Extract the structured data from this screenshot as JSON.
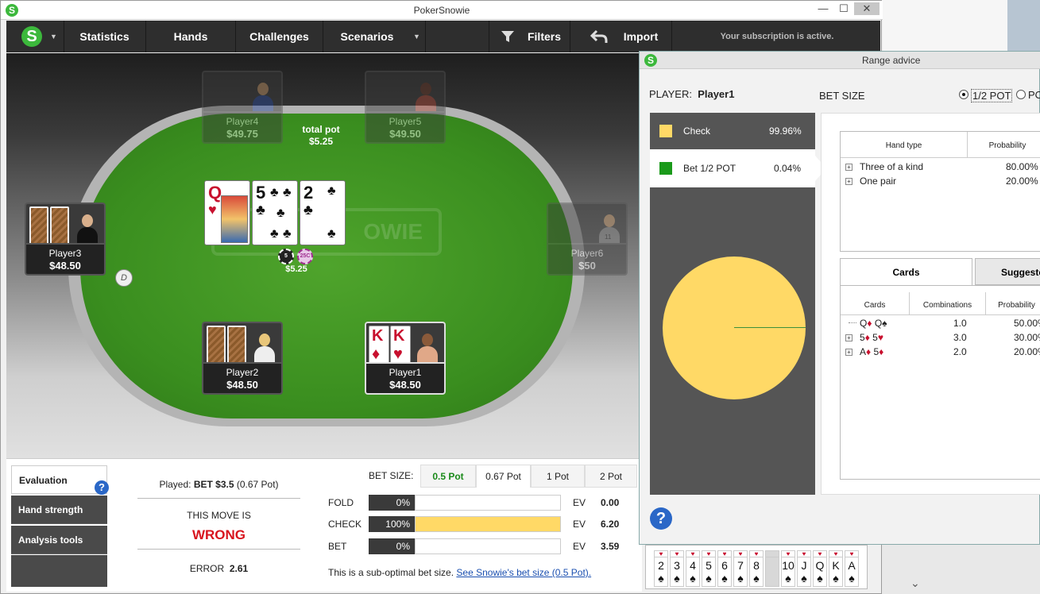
{
  "app": {
    "title": "PokerSnowie",
    "logo_letter": "S"
  },
  "window_buttons": {
    "minimize": "—",
    "maximize": "☐",
    "close": "✕"
  },
  "menu": {
    "items": [
      "Statistics",
      "Hands",
      "Challenges",
      "Scenarios"
    ],
    "filters": "Filters",
    "import": "Import",
    "subscription": "Your subscription is active."
  },
  "table": {
    "felt_logo": "OWIE",
    "total_pot_label": "total pot",
    "total_pot": "$5.25",
    "pot_chips": "$5.25",
    "chip1": "5",
    "chip2": "25C",
    "dealer": "D",
    "board": [
      {
        "rank": "Q",
        "suit": "♥",
        "color": "#c8102e"
      },
      {
        "rank": "5",
        "suit": "♣",
        "color": "#111111"
      },
      {
        "rank": "2",
        "suit": "♣",
        "color": "#111111"
      }
    ],
    "seats": [
      {
        "name": "Player4",
        "stack": "$49.75"
      },
      {
        "name": "Player5",
        "stack": "$49.50"
      },
      {
        "name": "Player3",
        "stack": "$48.50"
      },
      {
        "name": "Player6",
        "stack": "$50"
      },
      {
        "name": "Player2",
        "stack": "$48.50"
      },
      {
        "name": "Player1",
        "stack": "$48.50"
      }
    ],
    "hero_cards": [
      {
        "rank": "K",
        "suit": "♦"
      },
      {
        "rank": "K",
        "suit": "♥"
      }
    ],
    "player6_badge": "11"
  },
  "bottom": {
    "tabs": [
      "Evaluation",
      "Hand strength",
      "Analysis tools"
    ],
    "help": "?",
    "played_label": "Played:",
    "played_value": "BET $3.5",
    "played_extra": "(0.67 Pot)",
    "this_move_is": "THIS MOVE IS",
    "verdict": "WRONG",
    "error_label": "ERROR",
    "error_value": "2.61",
    "bet_size_label": "BET SIZE:",
    "bet_tabs": [
      "0.5 Pot",
      "0.67 Pot",
      "1 Pot",
      "2 Pot"
    ],
    "rows": [
      {
        "label": "FOLD",
        "pct": "0%",
        "fill": 0,
        "ev_label": "EV",
        "ev": "0.00"
      },
      {
        "label": "CHECK",
        "pct": "100%",
        "fill": 1,
        "ev_label": "EV",
        "ev": "6.20"
      },
      {
        "label": "BET",
        "pct": "0%",
        "fill": 0,
        "ev_label": "EV",
        "ev": "3.59"
      }
    ],
    "note": "This is a sub-optimal bet size.",
    "note_link": "See Snowie's bet size (0.5 Pot)."
  },
  "range": {
    "title": "Range advice",
    "player_label": "PLAYER:",
    "player_name": "Player1",
    "bet_size_label": "BET SIZE",
    "radio_half": "1/2 POT",
    "radio_pot": "PO",
    "actions": [
      {
        "name": "Check",
        "pct": "99.96%",
        "color": "#ffd966"
      },
      {
        "name": "Bet 1/2 POT",
        "pct": "0.04%",
        "color": "#1a9a1a"
      }
    ],
    "hand_type_headers": [
      "Hand type",
      "Probability"
    ],
    "hand_types": [
      {
        "type": "Three of a kind",
        "prob": "80.00%"
      },
      {
        "type": "One pair",
        "prob": "20.00%"
      }
    ],
    "tabs": [
      "Cards",
      "Suggeste"
    ],
    "cards_headers": [
      "Cards",
      "Combinations",
      "Probability"
    ],
    "cards_rows": [
      {
        "c1": "Q",
        "s1": "♦",
        "c2": "Q",
        "s2": "♠",
        "comb": "1.0",
        "prob": "50.00%"
      },
      {
        "c1": "5",
        "s1": "♦",
        "c2": "5",
        "s2": "♥",
        "comb": "3.0",
        "prob": "30.00%"
      },
      {
        "c1": "A",
        "s1": "♦",
        "c2": "5",
        "s2": "♦",
        "comb": "2.0",
        "prob": "20.00%"
      }
    ],
    "help": "?"
  },
  "mini_strip": {
    "ranks": [
      "2",
      "3",
      "4",
      "5",
      "6",
      "7",
      "8",
      "",
      "10",
      "J",
      "Q",
      "K",
      "A"
    ],
    "suit": "♠"
  },
  "scroll_arrow": "⌄"
}
